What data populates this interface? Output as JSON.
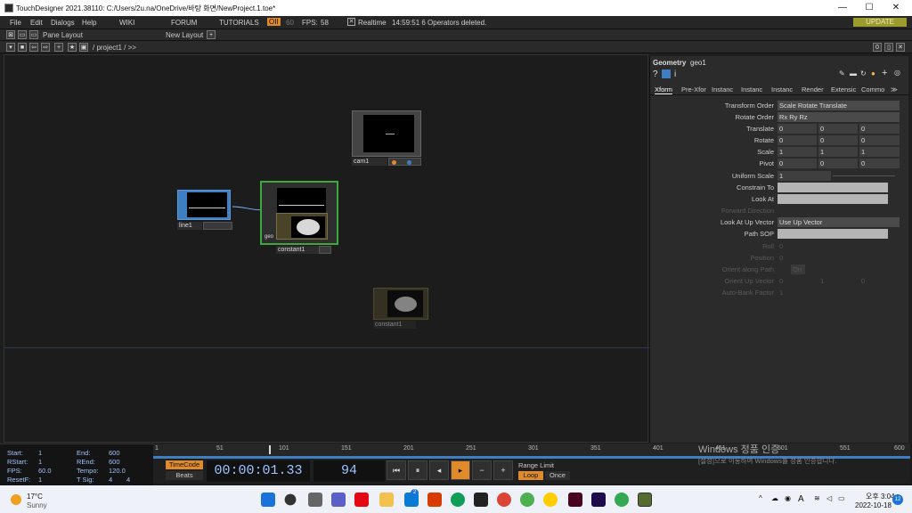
{
  "window": {
    "title": "TouchDesigner 2021.38110: C:/Users/2u.na/OneDrive/바탕 화면/NewProject.1.toe*"
  },
  "menu": {
    "file": "File",
    "edit": "Edit",
    "dialogs": "Dialogs",
    "help": "Help",
    "wiki": "WIKI",
    "forum": "FORUM",
    "tutorials": "TUTORIALS",
    "oii": "OII",
    "fps_target": "60",
    "fps_label": "FPS:",
    "fps_value": "58",
    "realtime": "Realtime",
    "status": "14:59:51 6 Operators deleted.",
    "update": "UPDATE"
  },
  "toolbar": {
    "pane_layout": "Pane Layout",
    "new_layout": "New Layout",
    "path": "/ project1 / >>"
  },
  "nodes": {
    "cam1": "cam1",
    "line1": "line1",
    "geo1": "geo",
    "constant1": "constant1",
    "constant_ghost": "constant1"
  },
  "param": {
    "type": "Geometry",
    "name": "geo1",
    "tabs": [
      "Xform",
      "Pre-Xfor",
      "Instanc",
      "Instanc",
      "Instanc",
      "Render",
      "Extensic",
      "Commo",
      "≫"
    ],
    "rows": {
      "transform_order": {
        "label": "Transform Order",
        "value": "Scale Rotate Translate"
      },
      "rotate_order": {
        "label": "Rotate Order",
        "value": "Rx Ry Rz"
      },
      "translate": {
        "label": "Translate",
        "x": "0",
        "y": "0",
        "z": "0"
      },
      "rotate": {
        "label": "Rotate",
        "x": "0",
        "y": "0",
        "z": "0"
      },
      "scale": {
        "label": "Scale",
        "x": "1",
        "y": "1",
        "z": "1"
      },
      "pivot": {
        "label": "Pivot",
        "x": "0",
        "y": "0",
        "z": "0"
      },
      "uniform_scale": {
        "label": "Uniform Scale",
        "value": "1"
      },
      "constrain_to": {
        "label": "Constrain To"
      },
      "look_at": {
        "label": "Look At"
      },
      "forward_direction": {
        "label": "Forward Direction"
      },
      "look_at_up_vector": {
        "label": "Look At Up Vector",
        "value": "Use Up Vector"
      },
      "path_sop": {
        "label": "Path SOP"
      },
      "roll": {
        "label": "Roll",
        "value": "0"
      },
      "position": {
        "label": "Position",
        "value": "0"
      },
      "orient_along_path": {
        "label": "Orient along Path",
        "value": "On"
      },
      "orient_up_vector": {
        "label": "Orient Up Vector",
        "x": "0",
        "y": "1",
        "z": "0"
      },
      "auto_bank_factor": {
        "label": "Auto-Bank Factor",
        "value": "1"
      }
    }
  },
  "stats": {
    "start_label": "Start:",
    "start": "1",
    "end_label": "End:",
    "end": "600",
    "rstart_label": "RStart:",
    "rstart": "1",
    "rend_label": "REnd:",
    "rend": "600",
    "fps_label": "FPS:",
    "fps": "60.0",
    "tempo_label": "Tempo:",
    "tempo": "120.0",
    "resetf_label": "ResetF:",
    "resetf": "1",
    "tsig_label": "T Sig:",
    "tsig_a": "4",
    "tsig_b": "4"
  },
  "timeline": {
    "ticks": [
      "1",
      "51",
      "101",
      "151",
      "201",
      "251",
      "301",
      "351",
      "401",
      "451",
      "501",
      "551",
      "600"
    ]
  },
  "transport": {
    "timecode_label": "TimeCode",
    "beats_label": "Beats",
    "time": "00:00:01.33",
    "frame": "94",
    "range_limit": "Range Limit",
    "loop": "Loop",
    "once": "Once"
  },
  "watermark": {
    "line1": "Windows 정품 인증",
    "line2": "[설정]으로 이동하여 Windows를 정품 인증합니다."
  },
  "taskbar": {
    "temp": "17°C",
    "weather": "Sunny",
    "time": "오후 3:04",
    "date": "2022-10-18",
    "lang": "A",
    "badge": "2",
    "notif": "12"
  },
  "colors": {
    "accent_orange": "#e08a2c",
    "geo_selected": "#3ea83e",
    "line_blue": "#3d7fc0",
    "update_btn": "#9c9c2e"
  }
}
